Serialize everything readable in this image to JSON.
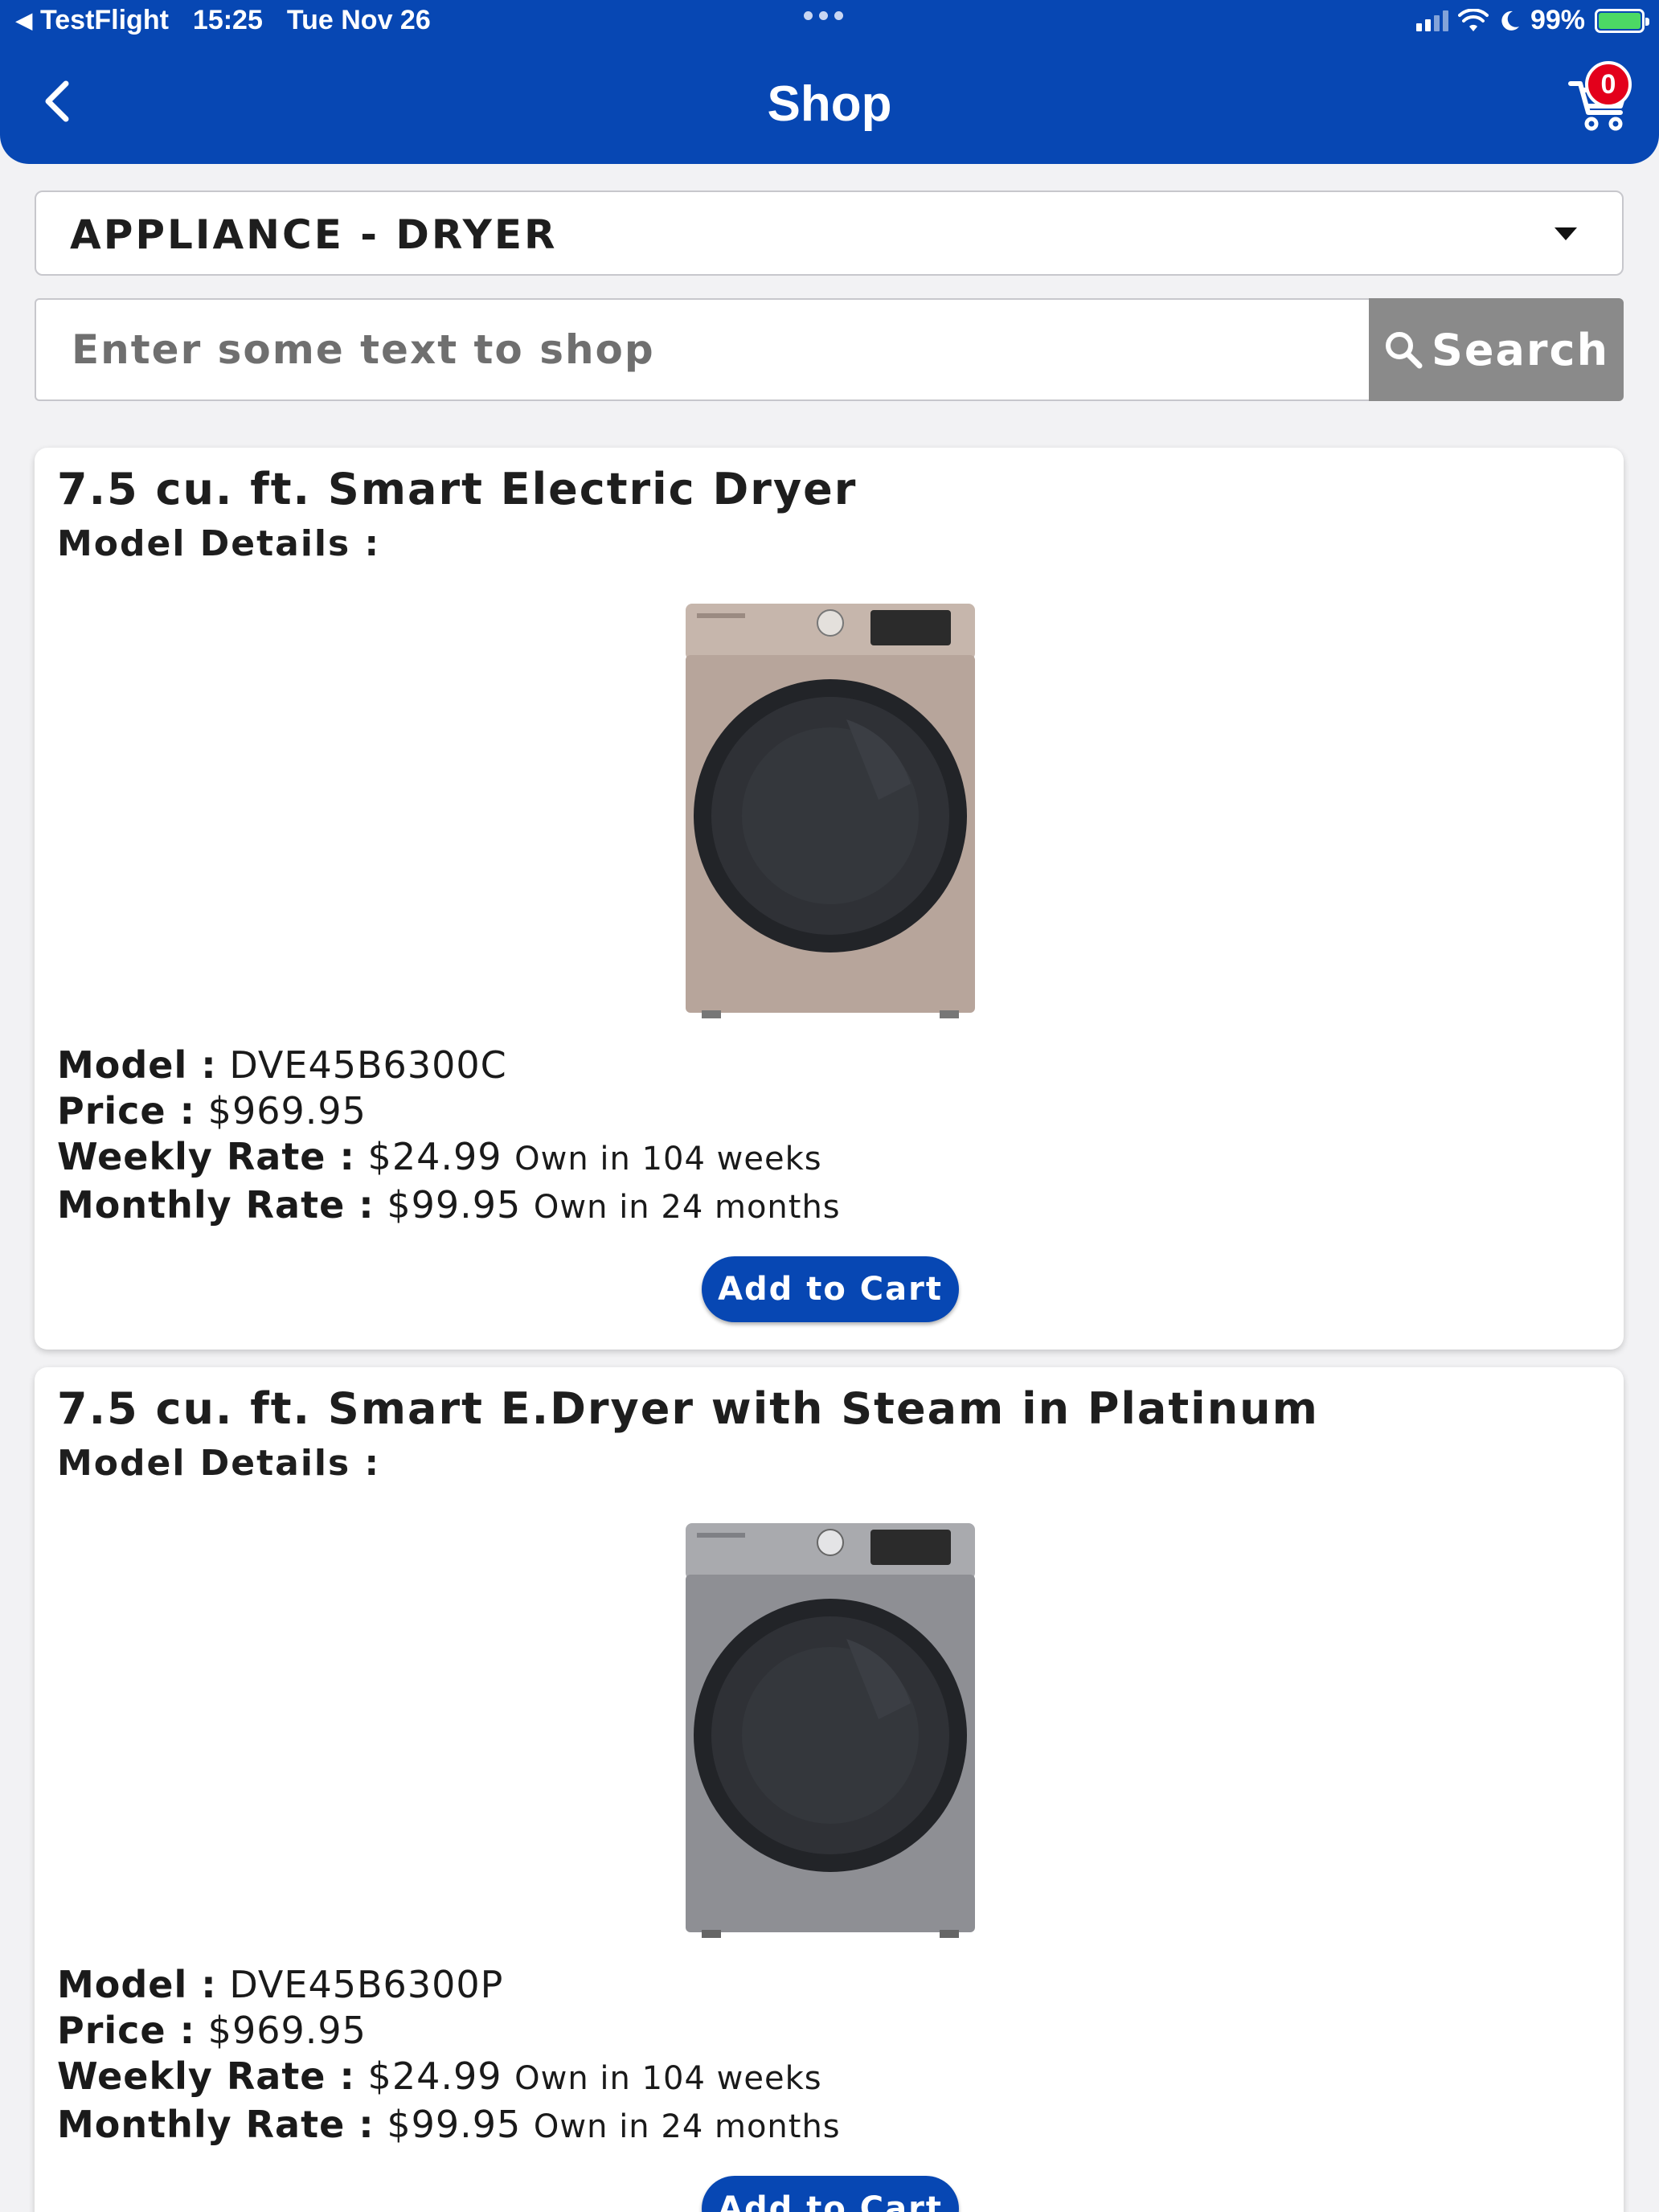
{
  "status_bar": {
    "back_app": "TestFlight",
    "time": "15:25",
    "date": "Tue Nov 26",
    "battery": "99%"
  },
  "nav": {
    "title": "Shop",
    "cart_count": "0"
  },
  "category": {
    "selected": "APPLIANCE - DRYER"
  },
  "search": {
    "placeholder": "Enter some text to shop",
    "button_label": "Search"
  },
  "labels": {
    "model_details": "Model Details :",
    "model": "Model :",
    "price": "Price :",
    "weekly_rate": "Weekly Rate :",
    "monthly_rate": "Monthly Rate :",
    "add_to_cart": "Add to Cart"
  },
  "products": [
    {
      "title": "7.5 cu. ft. Smart Electric Dryer",
      "model": "DVE45B6300C",
      "price": "$969.95",
      "weekly_rate": "$24.99",
      "weekly_term": "Own in 104 weeks",
      "monthly_rate": "$99.95",
      "monthly_term": "Own in 24 months",
      "finish_color": "#b7a59b"
    },
    {
      "title": "7.5 cu. ft. Smart E.Dryer with Steam in Platinum",
      "model": "DVE45B6300P",
      "price": "$969.95",
      "weekly_rate": "$24.99",
      "weekly_term": "Own in 104 weeks",
      "monthly_rate": "$99.95",
      "monthly_term": "Own in 24 months",
      "finish_color": "#8e8f94"
    }
  ],
  "colors": {
    "brand_blue": "#0747b3",
    "badge_red": "#e3001b",
    "search_button_gray": "#8a8a8a"
  }
}
